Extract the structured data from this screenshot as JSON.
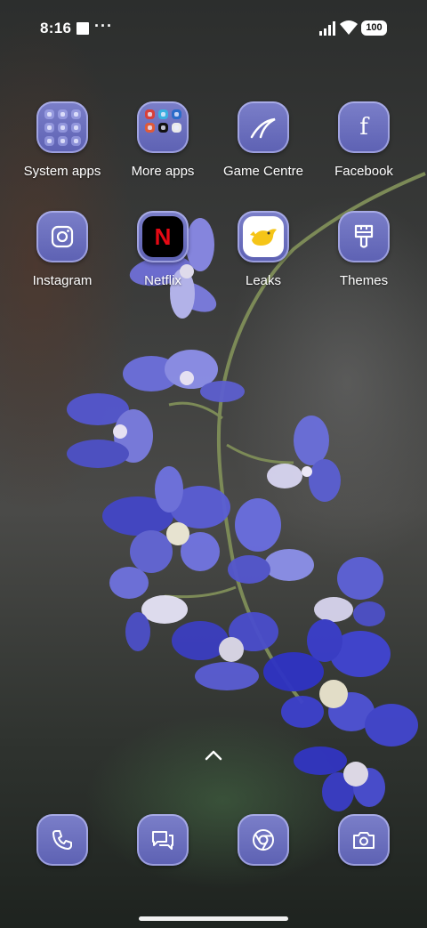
{
  "status_bar": {
    "time": "8:16",
    "notification_dots": "···",
    "battery_level": "100"
  },
  "home": {
    "apps": [
      {
        "label": "System apps",
        "icon": "folder-icon"
      },
      {
        "label": "More apps",
        "icon": "folder-icon"
      },
      {
        "label": "Game Centre",
        "icon": "game-centre-icon"
      },
      {
        "label": "Facebook",
        "icon": "facebook-icon"
      },
      {
        "label": "Instagram",
        "icon": "instagram-icon"
      },
      {
        "label": "Netflix",
        "icon": "netflix-icon"
      },
      {
        "label": "Leaks",
        "icon": "leaks-bird-icon"
      },
      {
        "label": "Themes",
        "icon": "themes-brush-icon"
      }
    ],
    "netflix_letter": "N",
    "facebook_letter": "f"
  },
  "dock": {
    "items": [
      {
        "icon": "phone-icon"
      },
      {
        "icon": "messages-icon"
      },
      {
        "icon": "chrome-icon"
      },
      {
        "icon": "camera-icon"
      }
    ]
  },
  "colors": {
    "icon_tile": "#6a6ebd",
    "netflix_red": "#e50914",
    "leaks_yellow": "#f5c518"
  }
}
